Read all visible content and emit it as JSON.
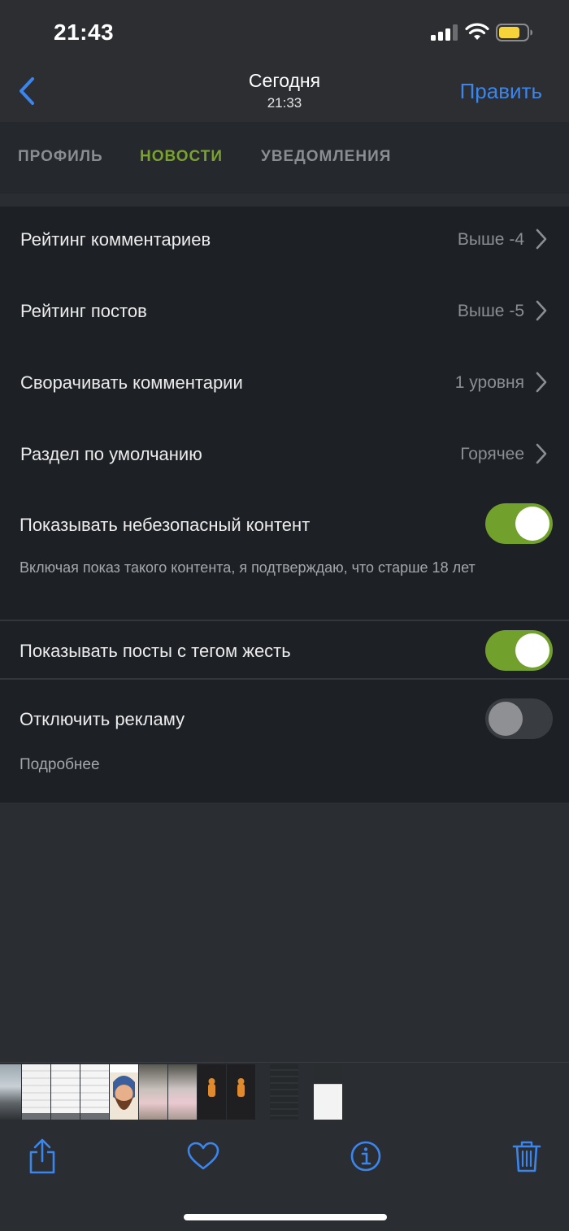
{
  "status_bar": {
    "time": "21:43"
  },
  "nav": {
    "title": "Сегодня",
    "subtitle": "21:33",
    "edit_label": "Править"
  },
  "tabs": [
    {
      "label": "ПРОФИЛЬ",
      "active": false
    },
    {
      "label": "НОВОСТИ",
      "active": true
    },
    {
      "label": "УВЕДОМЛЕНИЯ",
      "active": false
    }
  ],
  "settings": {
    "comment_rating": {
      "label": "Рейтинг комментариев",
      "value": "Выше -4"
    },
    "post_rating": {
      "label": "Рейтинг постов",
      "value": "Выше -5"
    },
    "collapse_comments": {
      "label": "Сворачивать комментарии",
      "value": "1 уровня"
    },
    "default_section": {
      "label": "Раздел по умолчанию",
      "value": "Горячее"
    },
    "unsafe_content": {
      "label": "Показывать небезопасный контент",
      "enabled": true,
      "note": "Включая показ такого контента, я подтверждаю, что старше 18 лет"
    },
    "gore_posts": {
      "label": "Показывать посты с тегом жесть",
      "enabled": true
    },
    "disable_ads": {
      "label": "Отключить рекламу",
      "enabled": false,
      "more_label": "Подробнее"
    }
  },
  "colors": {
    "accent_blue": "#3b86ee",
    "active_tab_green": "#7aa22e",
    "toggle_on": "#72a02c",
    "background": "#1d2024"
  },
  "toolbar": {
    "icons": [
      "share-icon",
      "heart-icon",
      "info-icon",
      "trash-icon"
    ]
  }
}
